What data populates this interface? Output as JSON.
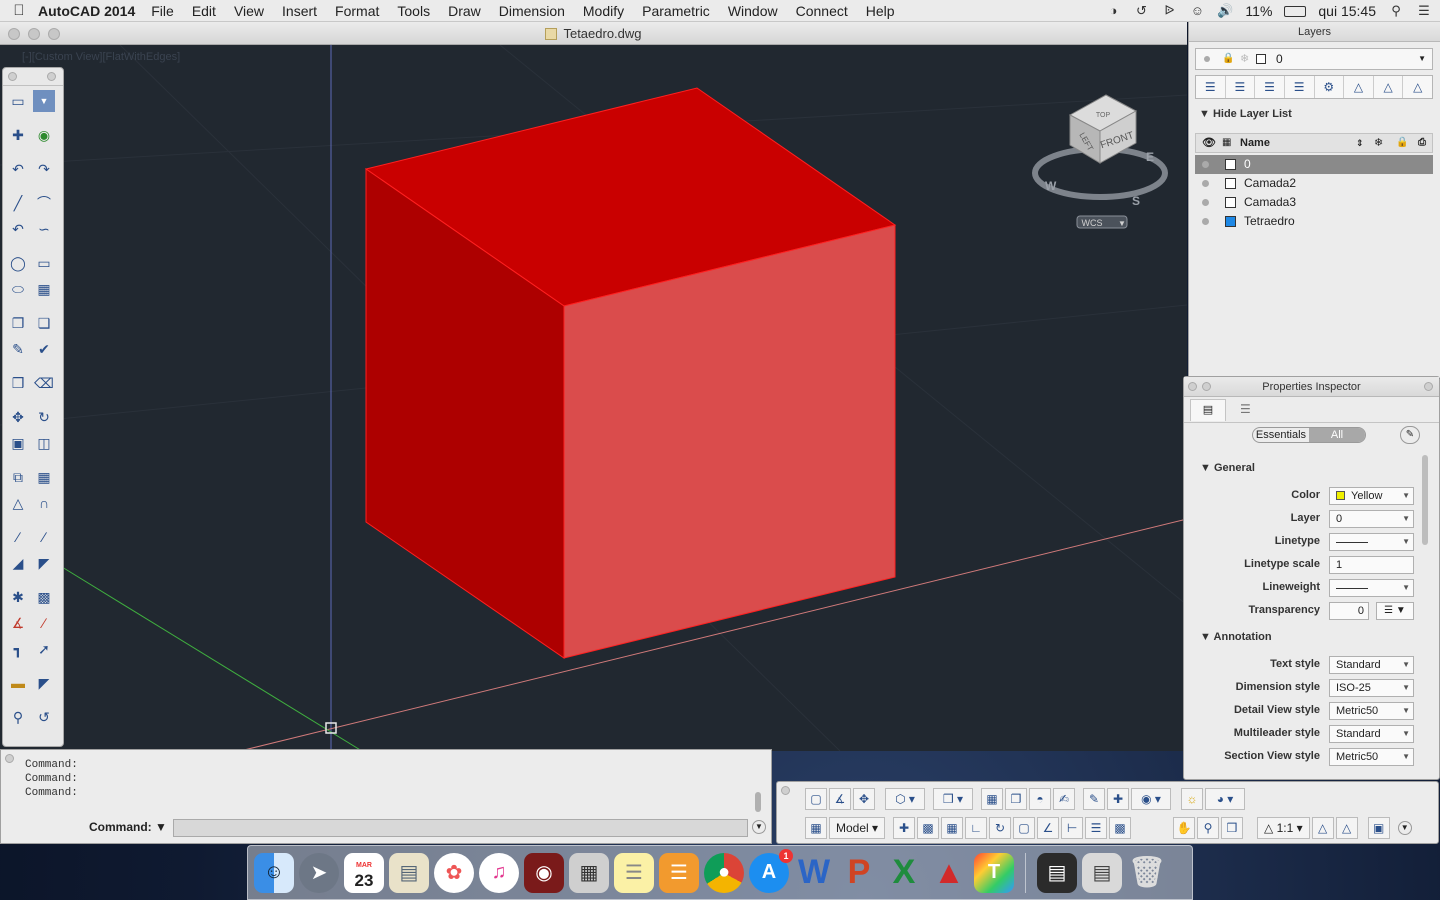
{
  "menubar": {
    "app_name": "AutoCAD 2014",
    "items": [
      "File",
      "Edit",
      "View",
      "Insert",
      "Format",
      "Tools",
      "Draw",
      "Dimension",
      "Modify",
      "Parametric",
      "Window",
      "Connect",
      "Help"
    ],
    "battery": "11%",
    "clock": "qui 15:45"
  },
  "window": {
    "title": "Tetaedro.dwg"
  },
  "viewport": {
    "view_label": "[-][Custom View][FlatWithEdges]",
    "viewcube": {
      "top": "TOP",
      "front": "FRONT",
      "left": "LEFT",
      "compass": [
        "W",
        "S",
        "E"
      ],
      "wcs": "WCS"
    },
    "cube_colors": {
      "top": "#c90000",
      "left": "#ad0000",
      "front": "#da4c4c",
      "edge": "#ff2020"
    }
  },
  "command": {
    "history": [
      "Command:",
      "Command:",
      "Command:"
    ],
    "prompt_label": "Command:"
  },
  "status": {
    "model_label": "Model",
    "scale": "1:1"
  },
  "layers": {
    "panel_title": "Layers",
    "current_layer": "0",
    "hide_list_label": "Hide Layer List",
    "name_column": "Name",
    "rows": [
      {
        "name": "0",
        "selected": true,
        "color": "#ffffff"
      },
      {
        "name": "Camada2",
        "selected": false,
        "color": "#ffffff"
      },
      {
        "name": "Camada3",
        "selected": false,
        "color": "#ffffff"
      },
      {
        "name": "Tetraedro",
        "selected": false,
        "color": "#1e88e5"
      }
    ]
  },
  "properties": {
    "panel_title": "Properties Inspector",
    "segment": [
      "Essentials",
      "All"
    ],
    "general_label": "General",
    "annotation_label": "Annotation",
    "general": [
      {
        "label": "Color",
        "value": "Yellow"
      },
      {
        "label": "Layer",
        "value": "0"
      },
      {
        "label": "Linetype",
        "value": ""
      },
      {
        "label": "Linetype scale",
        "value": "1"
      },
      {
        "label": "Lineweight",
        "value": ""
      },
      {
        "label": "Transparency",
        "value": "0"
      }
    ],
    "annotation": [
      {
        "label": "Text style",
        "value": "Standard"
      },
      {
        "label": "Dimension style",
        "value": "ISO-25"
      },
      {
        "label": "Detail View style",
        "value": "Metric50"
      },
      {
        "label": "Multileader style",
        "value": "Standard"
      },
      {
        "label": "Section View style",
        "value": "Metric50"
      }
    ]
  },
  "dock": {
    "calendar_month": "MAR",
    "calendar_day": "23",
    "appstore_badge": "1"
  }
}
